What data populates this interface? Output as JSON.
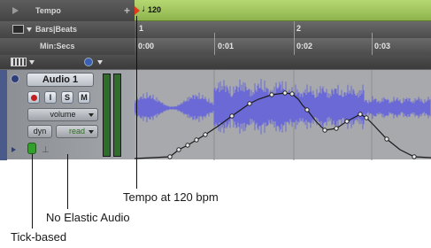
{
  "rulers": {
    "tempo_label": "Tempo",
    "tempo_value": "120",
    "bars_label": "Bars|Beats",
    "minsecs_label": "Min:Secs",
    "bar_ticks": [
      "1",
      "2"
    ],
    "time_ticks": [
      "0:00",
      "0:01",
      "0:02",
      "0:03"
    ]
  },
  "track": {
    "name": "Audio 1",
    "record_label": "",
    "input_label": "I",
    "solo_label": "S",
    "mute_label": "M",
    "view_label": "volume",
    "dyn_label": "dyn",
    "automation_mode": "read"
  },
  "callouts": {
    "tempo": "Tempo at 120 bpm",
    "elastic": "No Elastic Audio",
    "tick": "Tick-based"
  },
  "colors": {
    "tempo_ruler": "#9fc45a",
    "waveform": "#6a69d6",
    "track_bg": "#a8a9ad",
    "automation": "#1a1a1a"
  }
}
